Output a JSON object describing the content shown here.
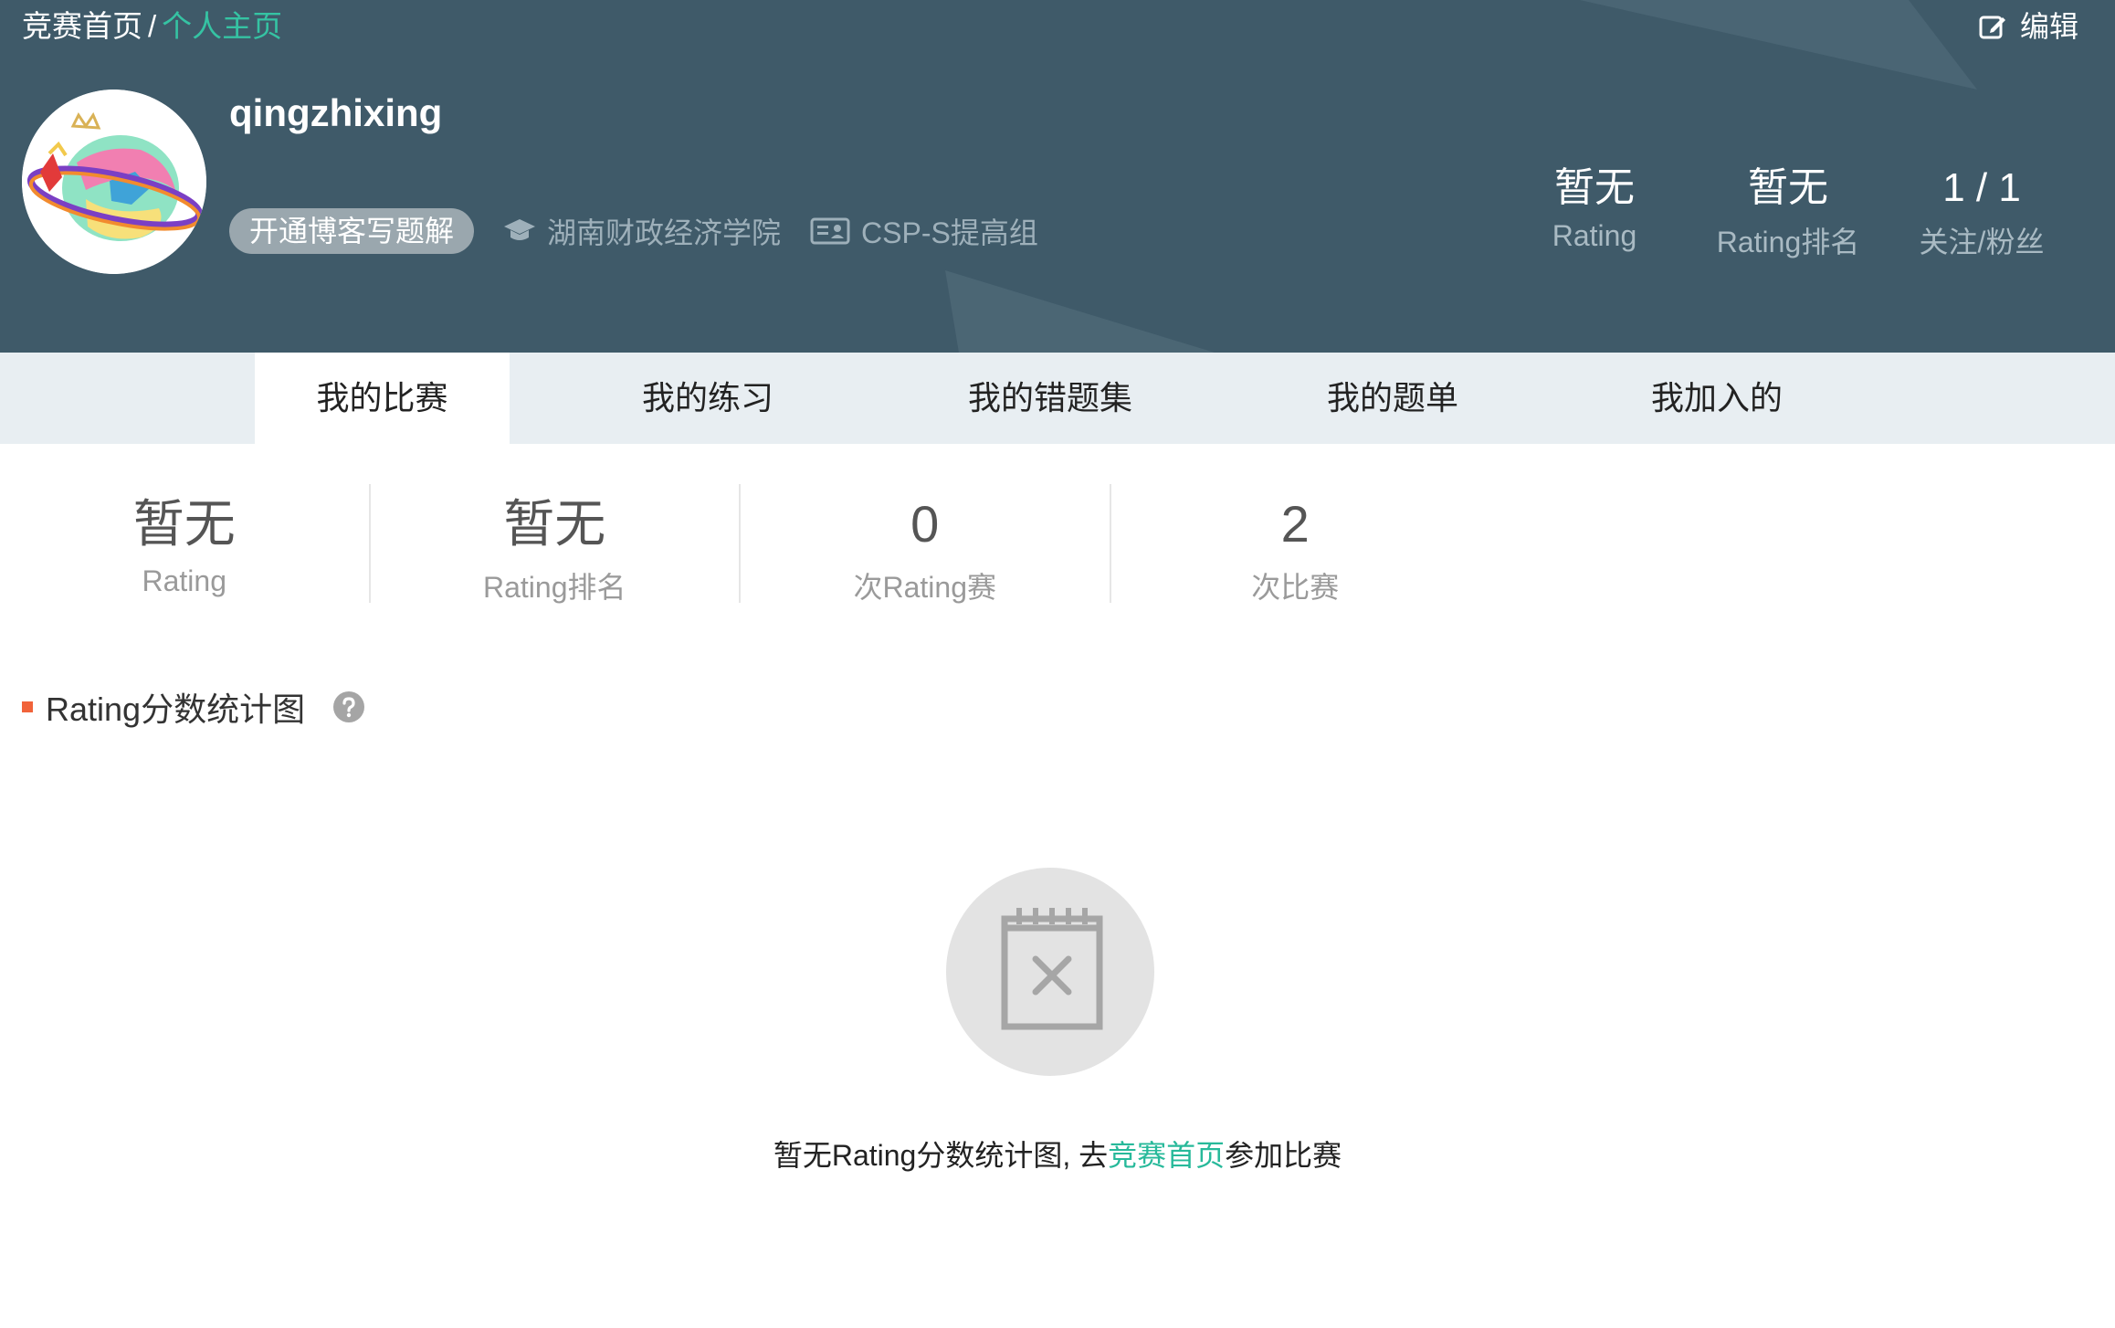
{
  "breadcrumb": {
    "home": "竞赛首页",
    "separator": "/",
    "current": "个人主页"
  },
  "header": {
    "edit_label": "编辑",
    "username": "qingzhixing",
    "blog_button": "开通博客写题解",
    "school": "湖南财政经济学院",
    "group": "CSP-S提高组",
    "stats": [
      {
        "value": "暂无",
        "label": "Rating"
      },
      {
        "value": "暂无",
        "label": "Rating排名"
      },
      {
        "value": "1 / 1",
        "label": "关注/粉丝"
      }
    ]
  },
  "tabs": [
    {
      "label": "我的比赛",
      "active": true
    },
    {
      "label": "我的练习",
      "active": false
    },
    {
      "label": "我的错题集",
      "active": false
    },
    {
      "label": "我的题单",
      "active": false
    },
    {
      "label": "我加入的",
      "active": false
    }
  ],
  "stats": [
    {
      "value": "暂无",
      "label": "Rating"
    },
    {
      "value": "暂无",
      "label": "Rating排名"
    },
    {
      "value": "0",
      "label": "次Rating赛"
    },
    {
      "value": "2",
      "label": "次比赛"
    }
  ],
  "section": {
    "title": "Rating分数统计图"
  },
  "empty": {
    "prefix": "暂无Rating分数统计图, 去",
    "link": "竞赛首页",
    "suffix": "参加比赛"
  },
  "colors": {
    "banner": "#3f5a69",
    "accent": "#35c3a3",
    "marker": "#f1633a",
    "tabs_bg": "#e8eef2"
  },
  "icons": [
    "edit-icon",
    "graduation-cap-icon",
    "id-card-icon",
    "help-icon",
    "empty-notepad-icon"
  ]
}
